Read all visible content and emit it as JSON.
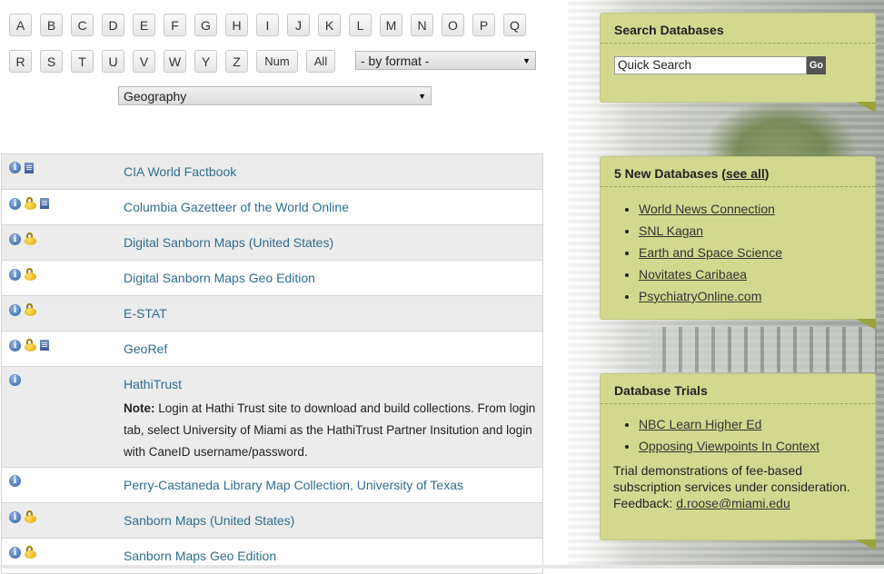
{
  "alphabet_row1": [
    "A",
    "B",
    "C",
    "D",
    "E",
    "F",
    "G",
    "H",
    "I",
    "J",
    "K",
    "L",
    "M",
    "N",
    "O",
    "P",
    "Q"
  ],
  "alphabet_row2": [
    "R",
    "S",
    "T",
    "U",
    "V",
    "W",
    "Y",
    "Z",
    "Num",
    "All"
  ],
  "format_select": {
    "value": "- by format -"
  },
  "subject_select": {
    "value": "Geography"
  },
  "databases": [
    {
      "title": "CIA World Factbook",
      "icons": [
        "info-icon",
        "document-icon"
      ]
    },
    {
      "title": "Columbia Gazetteer of the World Online",
      "icons": [
        "info-icon",
        "lock-icon",
        "document-icon"
      ]
    },
    {
      "title": "Digital Sanborn Maps (United States)",
      "icons": [
        "info-icon",
        "lock-icon"
      ]
    },
    {
      "title": "Digital Sanborn Maps Geo Edition",
      "icons": [
        "info-icon",
        "lock-icon"
      ]
    },
    {
      "title": "E-STAT",
      "icons": [
        "info-icon",
        "lock-icon"
      ]
    },
    {
      "title": "GeoRef",
      "icons": [
        "info-icon",
        "lock-icon",
        "document-icon"
      ]
    },
    {
      "title": "HathiTrust",
      "icons": [
        "info-icon"
      ],
      "note_label": "Note:",
      "note": " Login at Hathi Trust site to download and build collections. From login tab, select University of Miami as the HathiTrust Partner Insitution and login with CaneID username/password."
    },
    {
      "title": "Perry-Castaneda Library Map Collection, University of Texas",
      "icons": [
        "info-icon"
      ]
    },
    {
      "title": "Sanborn Maps (United States)",
      "icons": [
        "info-icon",
        "lock-icon"
      ]
    },
    {
      "title": "Sanborn Maps Geo Edition",
      "icons": [
        "info-icon",
        "lock-icon"
      ]
    }
  ],
  "search_panel": {
    "title": "Search Databases",
    "input_value": "Quick Search",
    "go_label": "Go"
  },
  "new_panel": {
    "title_prefix": "5 New Databases (",
    "see_all": "see all",
    "title_suffix": ")",
    "items": [
      "World News Connection",
      "SNL Kagan",
      "Earth and Space Science",
      "Novitates Caribaea",
      "PsychiatryOnline.com"
    ]
  },
  "trials_panel": {
    "title": "Database Trials",
    "items": [
      "NBC Learn Higher Ed",
      "Opposing Viewpoints In Context"
    ],
    "text": "Trial demonstrations of fee-based subscription services under consideration. Feedback: ",
    "email": "d.roose@miami.edu"
  },
  "colors": {
    "panel": "#d2d98f",
    "link": "#2f6e8e",
    "row_alt": "#ececec"
  }
}
